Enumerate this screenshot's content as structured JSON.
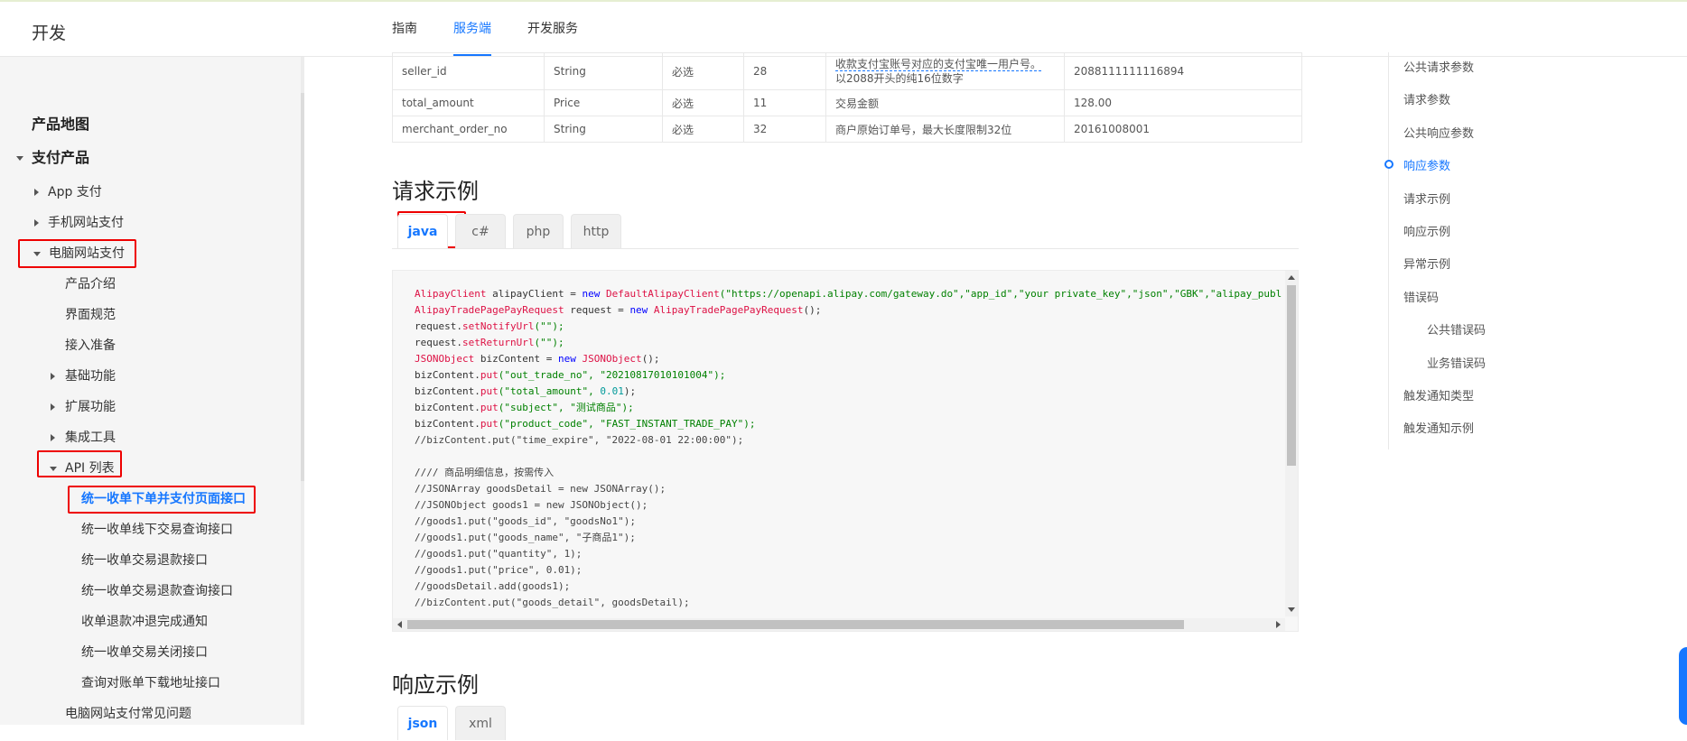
{
  "header": {
    "brand": "开发",
    "tabs": [
      {
        "label": "指南"
      },
      {
        "label": "服务端"
      },
      {
        "label": "开发服务"
      }
    ]
  },
  "sidebar": {
    "product_map": "产品地图",
    "pay_products": "支付产品",
    "app_pay": "App 支付",
    "mobile_web_pay": "手机网站支付",
    "pc_web_pay": "电脑网站支付",
    "children": {
      "intro": "产品介绍",
      "ui_spec": "界面规范",
      "prepare": "接入准备",
      "basic": "基础功能",
      "extend": "扩展功能",
      "tools": "集成工具",
      "api_list": "API 列表",
      "faq": "电脑网站支付常见问题"
    },
    "apis": [
      "统一收单下单并支付页面接口",
      "统一收单线下交易查询接口",
      "统一收单交易退款接口",
      "统一收单交易退款查询接口",
      "收单退款冲退完成通知",
      "统一收单交易关闭接口",
      "查询对账单下载地址接口"
    ]
  },
  "params_table": {
    "rows": [
      {
        "name": "seller_id",
        "type": "String",
        "required": "必选",
        "max_len": "28",
        "desc1": "收款支付宝账号对应的支付宝唯一用户号。",
        "desc2": "以2088开头的纯16位数字",
        "example": "2088111111116894"
      },
      {
        "name": "total_amount",
        "type": "Price",
        "required": "必选",
        "max_len": "11",
        "desc1": "交易金额",
        "desc2": "",
        "example": "128.00"
      },
      {
        "name": "merchant_order_no",
        "type": "String",
        "required": "必选",
        "max_len": "32",
        "desc1": "商户原始订单号，最大长度限制32位",
        "desc2": "",
        "example": "20161008001"
      }
    ]
  },
  "request_example": {
    "title": "请求示例",
    "tabs": [
      "java",
      "c#",
      "php",
      "http"
    ],
    "active_tab": "java",
    "code": {
      "l1_type": "AlipayClient",
      "l1_rest": " alipayClient = ",
      "l1_new": "new",
      "l1_ctor": " DefaultAlipayClient",
      "l1_args": "(\"https://openapi.alipay.com/gateway.do\",\"app_id\",\"your private_key\",\"json\",\"GBK\",\"alipay_publi",
      "l2_type": "AlipayTradePagePayRequest",
      "l2_rest": " request = ",
      "l2_new": "new",
      "l2_ctor": " AlipayTradePagePayRequest",
      "l2_end": "();",
      "l3_pre": "request.",
      "l3_m": "setNotifyUrl",
      "l3_s": "(\"\");",
      "l4_pre": "request.",
      "l4_m": "setReturnUrl",
      "l4_s": "(\"\");",
      "l5_type": "JSONObject",
      "l5_rest": " bizContent = ",
      "l5_new": "new",
      "l5_ctor": " JSONObject",
      "l5_end": "();",
      "l6_pre": "bizContent.",
      "l6_m": "put",
      "l6_s": "(\"out_trade_no\", \"20210817010101004\");",
      "l7_pre": "bizContent.",
      "l7_m": "put",
      "l7_s": "(\"total_amount\", ",
      "l7_n": "0.01",
      "l7_end": ");",
      "l8_pre": "bizContent.",
      "l8_m": "put",
      "l8_s": "(\"subject\", \"测试商品\");",
      "l9_pre": "bizContent.",
      "l9_m": "put",
      "l9_s": "(\"product_code\", \"FAST_INSTANT_TRADE_PAY\");",
      "l10": "//bizContent.put(\"time_expire\", \"2022-08-01 22:00:00\");",
      "l11": "",
      "l12": "//// 商品明细信息，按需传入",
      "l13": "//JSONArray goodsDetail = new JSONArray();",
      "l14": "//JSONObject goods1 = new JSONObject();",
      "l15": "//goods1.put(\"goods_id\", \"goodsNo1\");",
      "l16": "//goods1.put(\"goods_name\", \"子商品1\");",
      "l17": "//goods1.put(\"quantity\", 1);",
      "l18": "//goods1.put(\"price\", 0.01);",
      "l19": "//goodsDetail.add(goods1);",
      "l20": "//bizContent.put(\"goods_detail\", goodsDetail);"
    }
  },
  "response_example": {
    "title": "响应示例",
    "tabs": [
      "json",
      "xml"
    ]
  },
  "toc": {
    "items": [
      {
        "label": "公共请求参数"
      },
      {
        "label": "请求参数"
      },
      {
        "label": "公共响应参数"
      },
      {
        "label": "响应参数"
      },
      {
        "label": "请求示例"
      },
      {
        "label": "响应示例"
      },
      {
        "label": "异常示例"
      },
      {
        "label": "错误码"
      },
      {
        "label": "公共错误码"
      },
      {
        "label": "业务错误码"
      },
      {
        "label": "触发通知类型"
      },
      {
        "label": "触发通知示例"
      }
    ]
  },
  "colors": {
    "accent": "#1677ff",
    "highlight_box": "#ee0000"
  }
}
